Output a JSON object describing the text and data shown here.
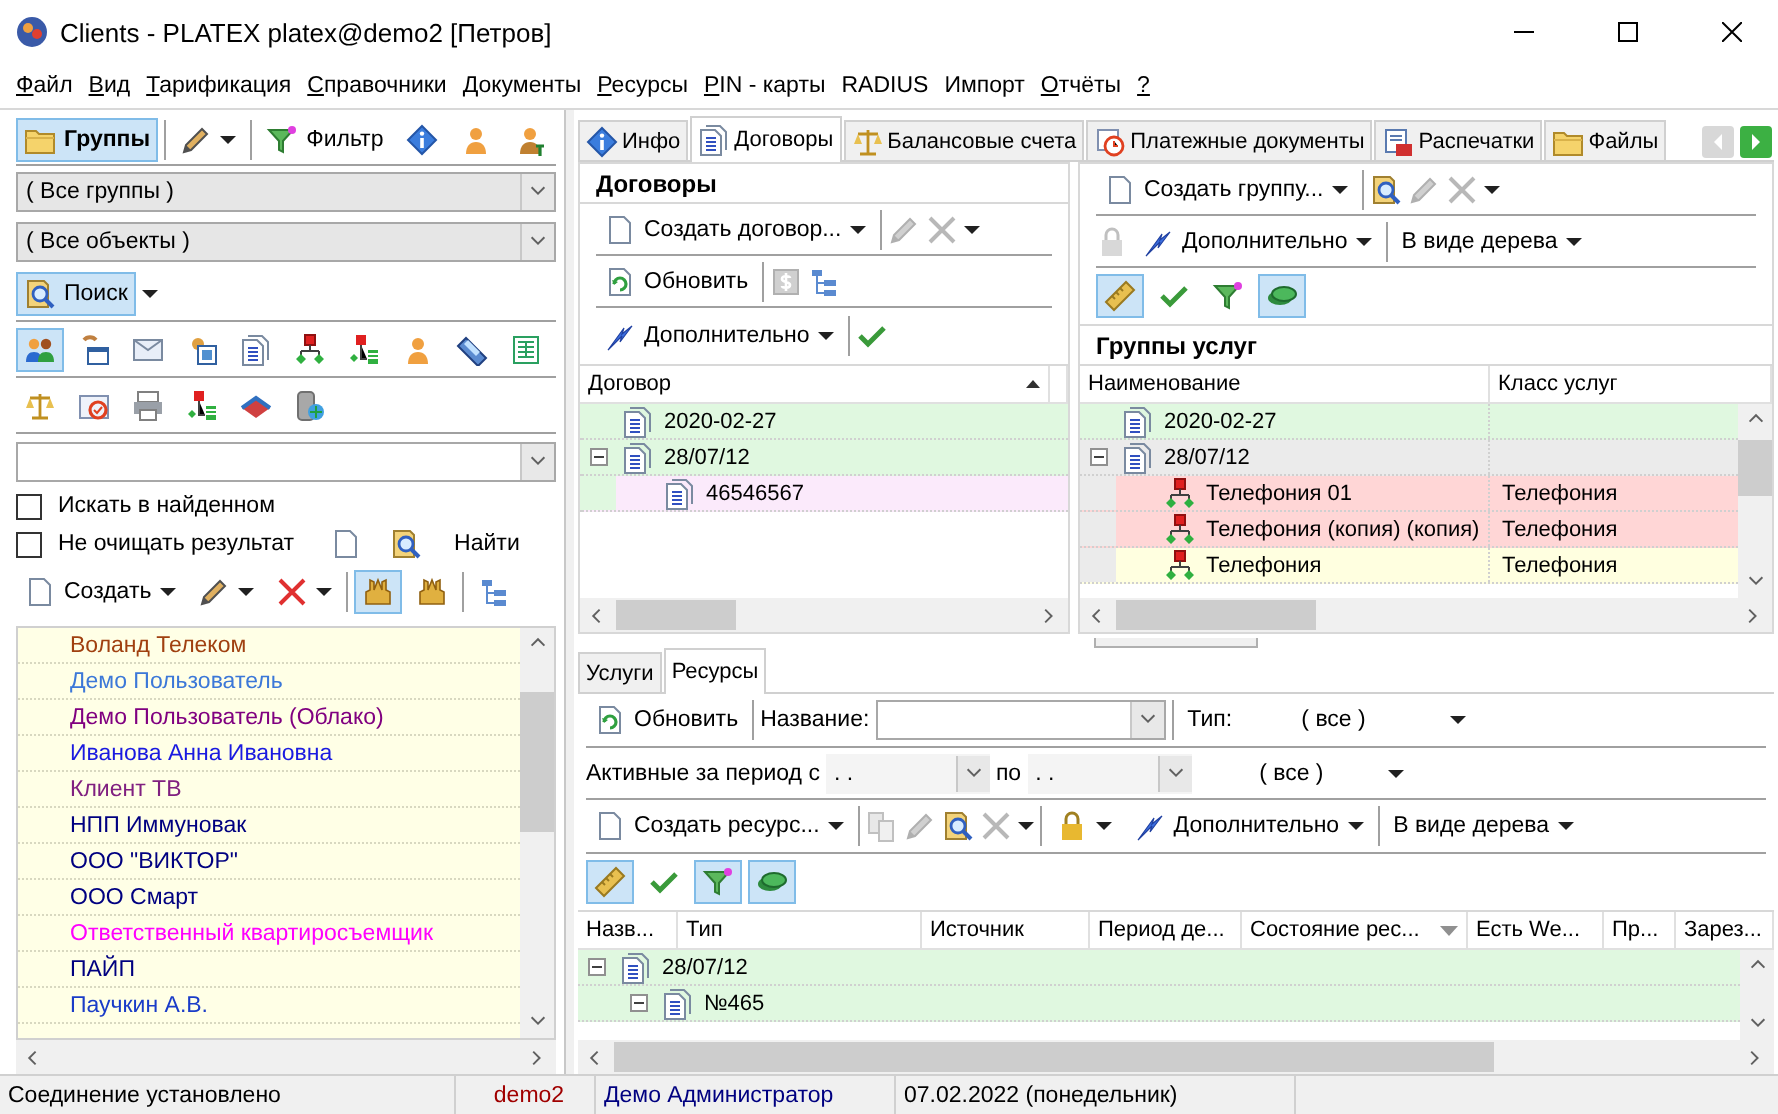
{
  "window": {
    "title": "Clients - PLATEX platex@demo2 [Петров]"
  },
  "menu": [
    {
      "label": "Файл",
      "underlined": true
    },
    {
      "label": "Вид",
      "underlined": true
    },
    {
      "label": "Тарификация",
      "underlined": true
    },
    {
      "label": "Справочники",
      "underlined": true
    },
    {
      "label": "Документы",
      "underlined": true
    },
    {
      "label": "Ресурсы",
      "underlined": true
    },
    {
      "label": "PIN - карты",
      "underlined": true
    },
    {
      "label": "RADIUS",
      "underlined": false
    },
    {
      "label": "Импорт",
      "underlined": false
    },
    {
      "label": "Отчёты",
      "underlined": true
    },
    {
      "label": "?",
      "underlined": true
    }
  ],
  "left_panel": {
    "groups_button": {
      "label": "Группы",
      "selected": true
    },
    "filter_button": {
      "label": "Фильтр"
    },
    "group_select": {
      "value": "( Все группы )"
    },
    "object_select": {
      "value": "( Все объекты )"
    },
    "search_button": {
      "label": "Поиск",
      "selected": true
    },
    "object_types": [
      {
        "selected": true
      },
      {
        "selected": false
      },
      {
        "selected": false
      },
      {
        "selected": false
      },
      {
        "selected": false
      },
      {
        "selected": false
      },
      {
        "selected": false
      },
      {
        "selected": false
      },
      {
        "selected": false
      },
      {
        "selected": false
      }
    ],
    "object_types_2": [
      {
        "selected": false
      },
      {
        "selected": false
      },
      {
        "selected": false
      },
      {
        "selected": false
      },
      {
        "selected": false
      },
      {
        "selected": false
      }
    ],
    "options": [
      {
        "label": "Искать в найденном",
        "checked": false
      },
      {
        "label": "Не очищать результат",
        "checked": false
      }
    ],
    "find_button": {
      "label": "Найти"
    },
    "create_button": {
      "label": "Создать"
    },
    "view_toggles": [
      {
        "selected": true
      },
      {
        "selected": false
      }
    ],
    "clients": [
      {
        "name": "Воланд Телеком",
        "color": "#a04010"
      },
      {
        "name": "Демо Пользователь",
        "color": "#3c78d8"
      },
      {
        "name": "Демо Пользователь (Облако)",
        "color": "#800080"
      },
      {
        "name": "Иванова Анна Ивановна",
        "color": "#1a1ae0"
      },
      {
        "name": "Клиент ТВ",
        "color": "#802080"
      },
      {
        "name": "НПП Иммуновак",
        "color": "#000080"
      },
      {
        "name": "ООО \"ВИКТОР\"",
        "color": "#000080"
      },
      {
        "name": "ООО Смарт",
        "color": "#000080"
      },
      {
        "name": "Ответственный квартиросъемщик",
        "color": "#ff00ff"
      },
      {
        "name": "ПАЙП",
        "color": "#000080"
      },
      {
        "name": "Паучкин А.В.",
        "color": "#1a3cc8"
      }
    ]
  },
  "tabs": [
    {
      "label": "Инфо",
      "selected": false
    },
    {
      "label": "Договоры",
      "selected": true
    },
    {
      "label": "Балансовые счета",
      "selected": false
    },
    {
      "label": "Платежные документы",
      "selected": false
    },
    {
      "label": "Распечатки",
      "selected": false
    },
    {
      "label": "Файлы",
      "selected": false
    }
  ],
  "contracts": {
    "title": "Договоры",
    "create_label": "Создать договор...",
    "refresh_label": "Обновить",
    "more_label": "Дополнительно",
    "column": {
      "label": "Договор",
      "sort_ascending": true
    },
    "rows": [
      {
        "name": "2020-02-27",
        "kind": "contract",
        "color": "#e0f8e0"
      },
      {
        "name": "28/07/12",
        "kind": "contract",
        "color": "#e0f8e0",
        "expanded": true,
        "children": [
          {
            "name": "46546567",
            "kind": "contract",
            "color": "#fbeafb"
          }
        ]
      }
    ]
  },
  "service_groups": {
    "title": "Группы услуг",
    "create_label": "Создать группу...",
    "more_label": "Дополнительно",
    "view_label": "В виде дерева",
    "toggles": [
      {
        "selected": true
      },
      {
        "selected": false
      },
      {
        "selected": false
      },
      {
        "selected": true
      }
    ],
    "columns": [
      "Наименование",
      "Класс услуг"
    ],
    "rows": [
      {
        "name": "2020-02-27",
        "kind": "contract",
        "color": "#e0f8e0"
      },
      {
        "name": "28/07/12",
        "kind": "contract",
        "color": "#ebebeb",
        "expanded": true,
        "children": [
          {
            "name": "Телефония 01",
            "class": "Телефония",
            "kind": "service",
            "color": "#ffd6d6"
          },
          {
            "name": "Телефония (копия) (копия)",
            "class": "Телефония",
            "kind": "service",
            "color": "#ffd6d6"
          },
          {
            "name": "Телефония",
            "class": "Телефония",
            "kind": "service",
            "color": "#ffffe0"
          }
        ]
      }
    ]
  },
  "bottom_tabs": [
    {
      "label": "Услуги",
      "selected": false
    },
    {
      "label": "Ресурсы",
      "selected": true
    }
  ],
  "resources": {
    "refresh_label": "Обновить",
    "name_label": "Название:",
    "type_label": "Тип:",
    "type_value": "( все )",
    "period_label": "Активные за период с",
    "from_value": ". .",
    "to_label": "по",
    "to_value": ". .",
    "state_value": "( все )",
    "create_label": "Создать ресурс...",
    "more_label": "Дополнительно",
    "view_label": "В виде дерева",
    "toggles": [
      {
        "selected": true
      },
      {
        "selected": false
      },
      {
        "selected": true
      },
      {
        "selected": true
      }
    ],
    "columns": [
      {
        "label": "Назв..."
      },
      {
        "label": "Тип"
      },
      {
        "label": "Источник"
      },
      {
        "label": "Период де..."
      },
      {
        "label": "Состояние рес...",
        "sort_descending": true
      },
      {
        "label": "Есть We..."
      },
      {
        "label": "Пр..."
      },
      {
        "label": "Зарез..."
      }
    ],
    "rows": [
      {
        "name": "28/07/12",
        "kind": "contract",
        "color": "#e0f8e0",
        "expanded": true,
        "children": [
          {
            "name": "№465",
            "kind": "contract",
            "color": "#e0f8e0",
            "expanded": true
          }
        ]
      }
    ]
  },
  "status_bar": [
    {
      "text": "Соединение установлено",
      "color": "#000000"
    },
    {
      "text": "demo2",
      "color": "#a00000"
    },
    {
      "text": "Демо Администратор",
      "color": "#000080"
    },
    {
      "text": "07.02.2022 (понедельник)",
      "color": "#000000"
    }
  ]
}
